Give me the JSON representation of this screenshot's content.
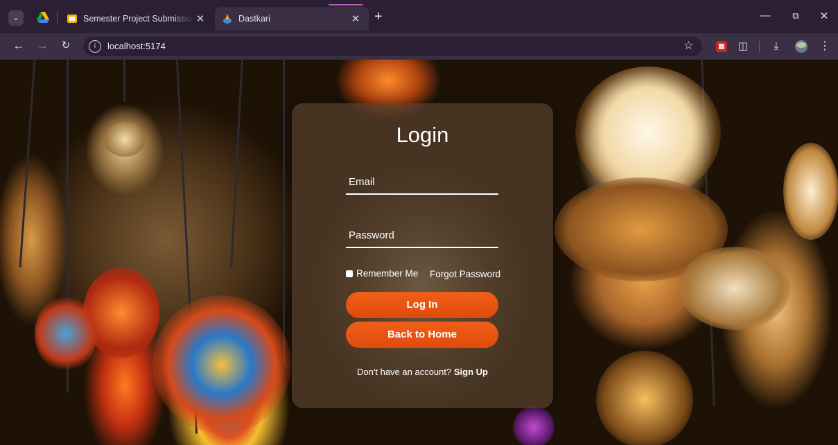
{
  "browser": {
    "tabs": [
      {
        "title": "Semester Project Submission (L",
        "active": false
      },
      {
        "title": "Dastkari",
        "active": true
      }
    ],
    "address": "localhost:5174"
  },
  "login": {
    "title": "Login",
    "email_placeholder": "Email",
    "password_placeholder": "Password",
    "remember_label": "Remember Me",
    "forgot_label": "Forgot Password",
    "login_button": "Log In",
    "home_button": "Back to Home",
    "signup_prompt": "Don't have an account?",
    "signup_link": "Sign Up"
  },
  "colors": {
    "accent": "#e8520f",
    "chrome_dark": "#2a1f33",
    "chrome_toolbar": "#3a2f45"
  }
}
